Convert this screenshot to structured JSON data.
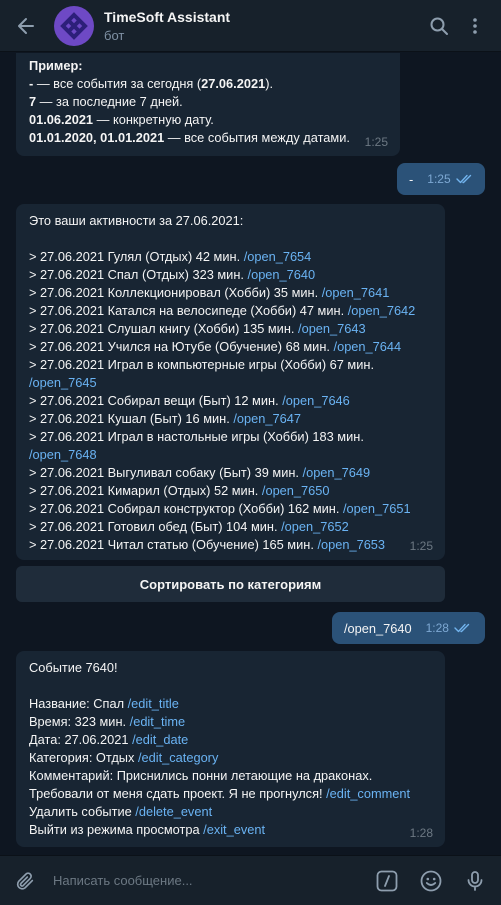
{
  "header": {
    "title": "TimeSoft Assistant",
    "status": "бот"
  },
  "msg_example": {
    "heading": "Пример:",
    "l1_a": "-",
    "l1_b": " — все события за сегодня (",
    "l1_c": "27.06.2021",
    "l1_d": ").",
    "l2_a": "7",
    "l2_b": " — за последние 7 дней.",
    "l3_a": "01.06.2021",
    "l3_b": " — конкретную дату.",
    "l4_a": "01.01.2020, 01.01.2021",
    "l4_b": " — все события между датами.",
    "time": "1:25"
  },
  "out1": {
    "text": "-",
    "time": "1:25"
  },
  "msg_activities": {
    "intro": "Это ваши активности за 27.06.2021:",
    "time": "1:25",
    "items": [
      {
        "text": ">  27.06.2021 Гулял (Отдых) 42 мин. ",
        "link": "/open_7654"
      },
      {
        "text": ">  27.06.2021 Спал (Отдых) 323 мин. ",
        "link": "/open_7640"
      },
      {
        "text": ">  27.06.2021 Коллекционировал (Хобби) 35 мин. ",
        "link": "/open_7641"
      },
      {
        "text": ">  27.06.2021 Катался на велосипеде (Хобби) 47 мин. ",
        "link": "/open_7642"
      },
      {
        "text": ">  27.06.2021 Слушал книгу (Хобби) 135 мин. ",
        "link": "/open_7643"
      },
      {
        "text": ">  27.06.2021 Учился на Ютубе (Обучение) 68 мин. ",
        "link": "/open_7644"
      },
      {
        "text": ">  27.06.2021 Играл в компьютерные игры (Хобби) 67 мин.",
        "link": "/open_7645"
      },
      {
        "text": ">  27.06.2021 Собирал вещи (Быт) 12 мин. ",
        "link": "/open_7646"
      },
      {
        "text": ">  27.06.2021 Кушал (Быт) 16 мин. ",
        "link": "/open_7647"
      },
      {
        "text": ">  27.06.2021 Играл в настольные игры (Хобби) 183 мин.",
        "link": "/open_7648"
      },
      {
        "text": ">  27.06.2021 Выгуливал собаку (Быт) 39 мин. ",
        "link": "/open_7649"
      },
      {
        "text": ">  27.06.2021 Кимарил (Отдых) 52 мин. ",
        "link": "/open_7650"
      },
      {
        "text": ">  27.06.2021 Собирал конструктор (Хобби) 162 мин. ",
        "link": "/open_7651"
      },
      {
        "text": ">  27.06.2021 Готовил обед (Быт) 104 мин. ",
        "link": "/open_7652"
      },
      {
        "text": ">  27.06.2021 Читал статью (Обучение) 165 мин. ",
        "link": "/open_7653"
      }
    ]
  },
  "keyboard": {
    "sort_label": "Сортировать по категориям"
  },
  "out2": {
    "text": "/open_7640",
    "time": "1:28"
  },
  "msg_event": {
    "heading": "Событие 7640!",
    "name_label": "Название: Спал ",
    "name_link": "/edit_title",
    "time_label": "Время: 323 мин. ",
    "time_link": "/edit_time",
    "date_label": "Дата: 27.06.2021 ",
    "date_link": "/edit_date",
    "cat_label": "Категория: Отдых ",
    "cat_link": "/edit_category",
    "comment_l1": "Комментарий: Приснились понни летающие на драконах.",
    "comment_l2": "Требовали от меня сдать проект. Я не прогнулся! ",
    "comment_link": "/edit_comment",
    "delete_label": "Удалить событие ",
    "delete_link": "/delete_event",
    "exit_label": "Выйти из режима просмотра ",
    "exit_link": "/exit_event",
    "time": "1:28"
  },
  "composer": {
    "placeholder": "Написать сообщение..."
  }
}
